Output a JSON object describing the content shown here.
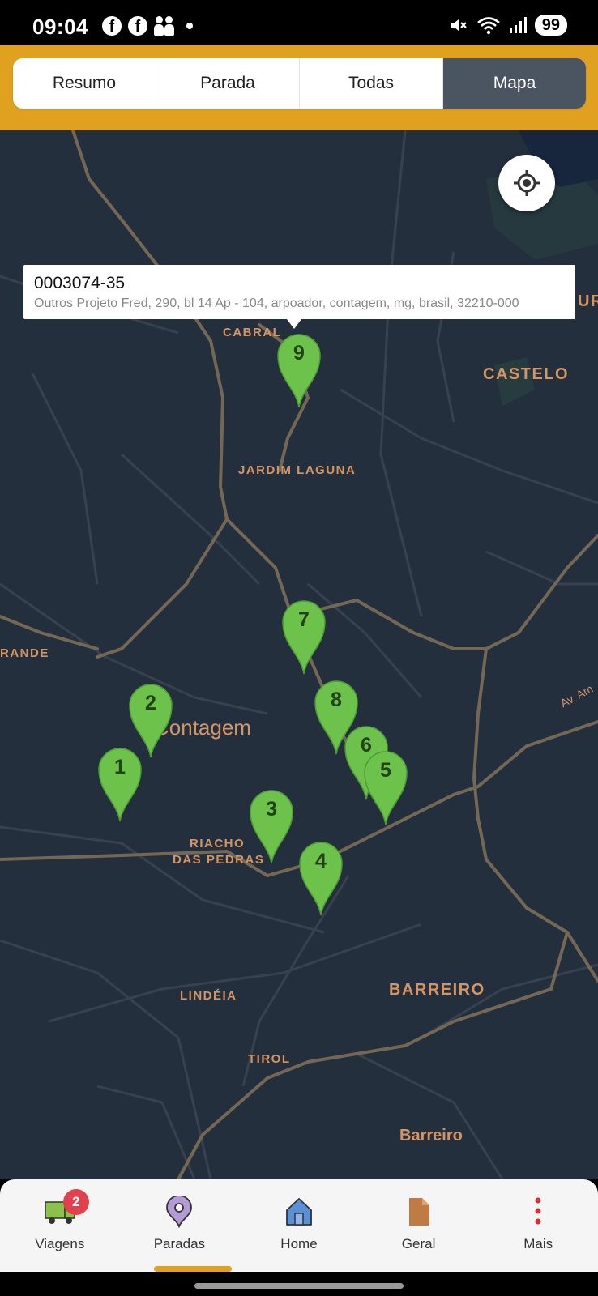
{
  "status_bar": {
    "time": "09:04",
    "battery": "99",
    "icons": [
      "facebook-icon",
      "facebook-icon",
      "people-icon",
      "dot-icon",
      "mute-icon",
      "wifi-icon",
      "signal-icon"
    ]
  },
  "tabs": [
    {
      "label": "Resumo",
      "active": false
    },
    {
      "label": "Parada",
      "active": false
    },
    {
      "label": "Todas",
      "active": false
    },
    {
      "label": "Mapa",
      "active": true
    }
  ],
  "colors": {
    "header": "#e0a020",
    "active_tab": "#4b5461",
    "map_bg": "#242f3e",
    "marker": "#6cc24a",
    "badge": "#e0414d"
  },
  "map": {
    "info_window": {
      "title": "0003074-35",
      "address": "Outros Projeto Fred, 290, bl 14 Ap - 104, arpoador, contagem, mg, brasil, 32210-000"
    },
    "labels": {
      "cabral": "CABRAL",
      "castelo": "CASTELO",
      "jardim_laguna": "JARDIM LAGUNA",
      "rande": "RANDE",
      "contagem": "Contagem",
      "riacho_1": "RIACHO",
      "riacho_2": "DAS PEDRAS",
      "lindeia": "LINDÉIA",
      "barreiro_upper": "BARREIRO",
      "tirol": "TIROL",
      "barreiro": "Barreiro",
      "av_am": "Av. Am",
      "edge_ur": "UR"
    },
    "markers": [
      "1",
      "2",
      "3",
      "4",
      "5",
      "6",
      "7",
      "8",
      "9"
    ]
  },
  "bottom_nav": [
    {
      "label": "Viagens",
      "icon": "truck-icon",
      "badge": "2"
    },
    {
      "label": "Paradas",
      "icon": "location-pin-icon"
    },
    {
      "label": "Home",
      "icon": "home-icon"
    },
    {
      "label": "Geral",
      "icon": "document-icon"
    },
    {
      "label": "Mais",
      "icon": "more-vertical-icon"
    }
  ]
}
